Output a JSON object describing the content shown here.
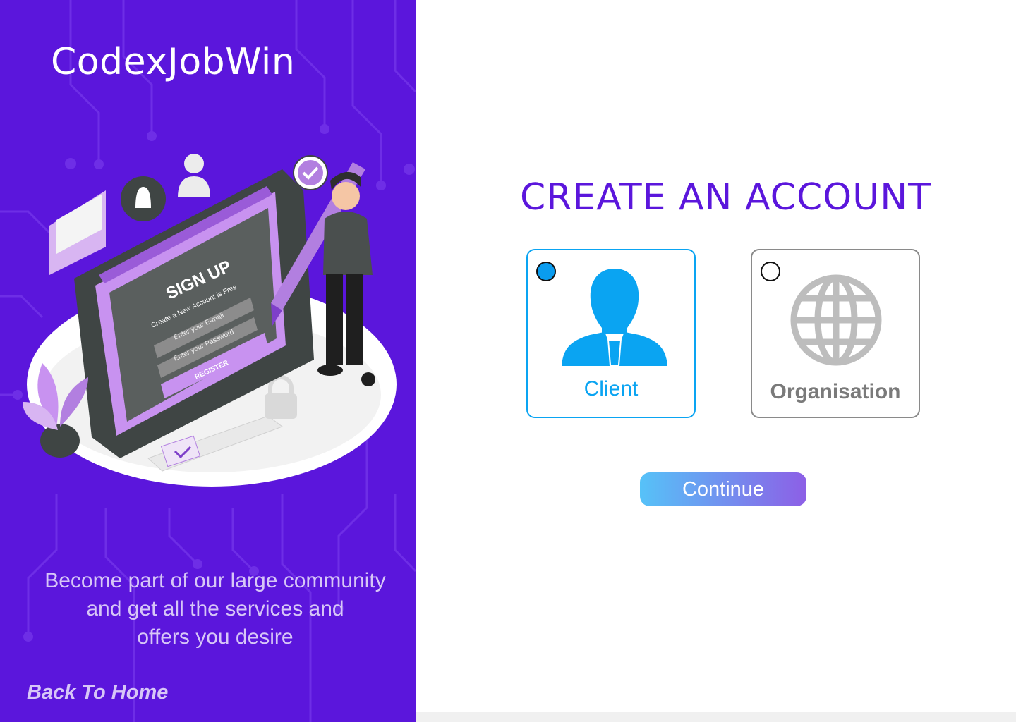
{
  "brand": {
    "name": "CodexJobWin"
  },
  "illustration": {
    "heading": "SIGN UP",
    "subheading": "Create a New Account is Free",
    "email_placeholder": "Enter your E-mail",
    "password_placeholder": "Enter your Password",
    "register_label": "REGISTER"
  },
  "left_panel": {
    "tagline_lines": [
      "Become part of our large community",
      "and get all the services and",
      "offers you desire"
    ],
    "back_link": "Back To Home"
  },
  "main": {
    "title": "CREATE AN ACCOUNT",
    "options": [
      {
        "label": "Client",
        "icon": "person-icon",
        "selected": true
      },
      {
        "label": "Organisation",
        "icon": "globe-icon",
        "selected": false
      }
    ],
    "continue_label": "Continue"
  },
  "colors": {
    "panel_bg": "#5b16dc",
    "accent_blue": "#0aa4f2",
    "title_purple": "#5b16dc",
    "button_gradient_start": "#56c2f8",
    "button_gradient_end": "#8d5fe6"
  }
}
